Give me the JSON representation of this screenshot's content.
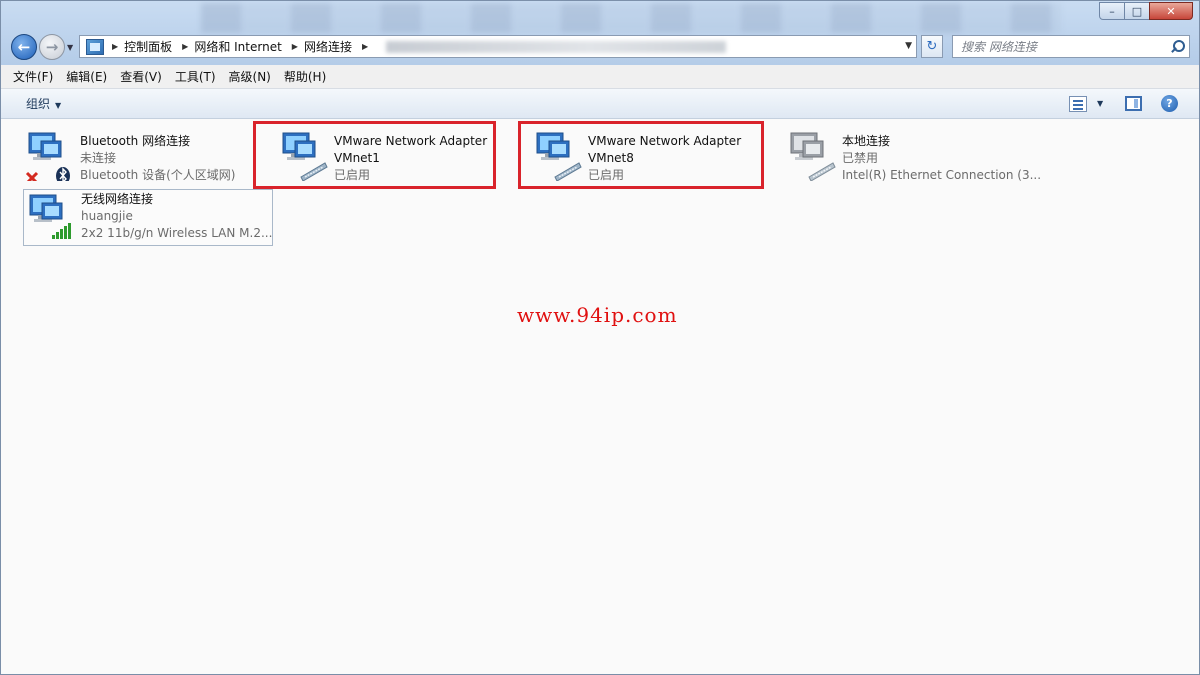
{
  "window": {
    "caption_buttons": {
      "minimize": "–",
      "maximize": "□",
      "close": "✕"
    }
  },
  "nav": {
    "back_glyph": "←",
    "forward_glyph": "→"
  },
  "address": {
    "crumbs": [
      "控制面板",
      "网络和 Internet",
      "网络连接"
    ],
    "separator_glyph": "▶",
    "dropdown_glyph": "▼"
  },
  "search": {
    "placeholder": "搜索 网络连接"
  },
  "refresh_glyph": "↻",
  "menubar": {
    "items": [
      "文件(F)",
      "编辑(E)",
      "查看(V)",
      "工具(T)",
      "高级(N)",
      "帮助(H)"
    ]
  },
  "toolbar": {
    "organize_label": "组织",
    "dropdown_glyph": "▼",
    "help_glyph": "?"
  },
  "connections": [
    {
      "name": "Bluetooth 网络连接",
      "status": "未连接",
      "device": "Bluetooth 设备(个人区域网)",
      "icon": "bluetooth-disconnected-icon"
    },
    {
      "name": "VMware Network Adapter",
      "status": "VMnet1",
      "device": "已启用",
      "icon": "network-adapter-icon"
    },
    {
      "name": "VMware Network Adapter",
      "status": "VMnet8",
      "device": "已启用",
      "icon": "network-adapter-icon"
    },
    {
      "name": "本地连接",
      "status": "已禁用",
      "device": "Intel(R) Ethernet Connection (3...",
      "icon": "network-adapter-disabled-icon"
    },
    {
      "name": "无线网络连接",
      "status": "huangjie",
      "device": "2x2 11b/g/n Wireless LAN M.2...",
      "icon": "wireless-signal-icon"
    }
  ],
  "watermark": "www.94ip.com",
  "colors": {
    "highlight": "#d9232b",
    "watermark": "#e01010",
    "accent": "#1d5fb8"
  }
}
